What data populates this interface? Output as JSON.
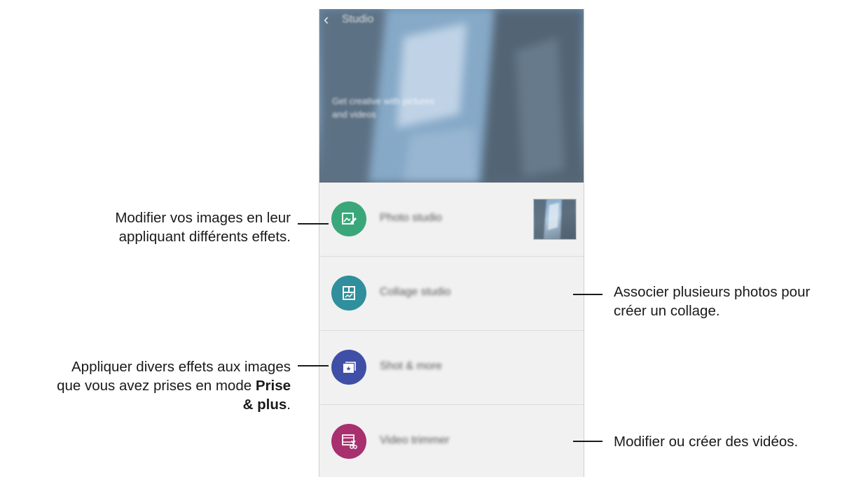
{
  "app": {
    "title": "Studio",
    "tagline": "Get creative with pictures and videos"
  },
  "items": [
    {
      "label": "Photo studio",
      "icon": "photo-edit-icon",
      "color": "#3aa77a"
    },
    {
      "label": "Collage studio",
      "icon": "collage-icon",
      "color": "#2f8f9c"
    },
    {
      "label": "Shot & more",
      "icon": "shot-more-icon",
      "color": "#3f4fa6"
    },
    {
      "label": "Video trimmer",
      "icon": "video-trim-icon",
      "color": "#a8306e"
    }
  ],
  "callouts": {
    "photo_studio_line1": "Modifier vos images en leur",
    "photo_studio_line2": "appliquant différents effets.",
    "collage_line1": "Associer plusieurs photos pour",
    "collage_line2": "créer un collage.",
    "shot_line1": "Appliquer divers effets aux images",
    "shot_line2": "que vous avez prises en mode",
    "shot_bold1": "Prise",
    "shot_bold2": "& plus",
    "shot_end": ".",
    "video": "Modifier ou créer des vidéos."
  }
}
